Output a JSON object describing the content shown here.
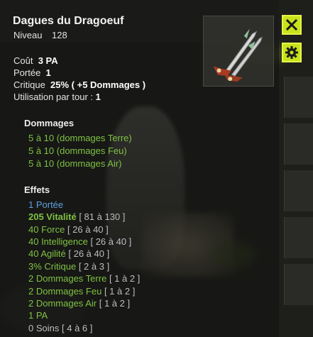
{
  "item": {
    "name": "Dagues du Dragoeuf",
    "level_label": "Niveau",
    "level_value": "128",
    "image_icon": "dragon-dagger-icon"
  },
  "buttons": {
    "close_icon": "close-icon",
    "settings_icon": "gear-icon",
    "accent": "#c8e21c"
  },
  "stats": {
    "cost_label": "Coût",
    "cost_value": "3 PA",
    "range_label": "Portée",
    "range_value": "1",
    "crit_label": "Critique",
    "crit_value": "25% ( +5 Dommages )",
    "uses_label": "Utilisation par tour :",
    "uses_value": "1"
  },
  "damages": {
    "title": "Dommages",
    "lines": [
      "5 à 10 (dommages Terre)",
      "5 à 10 (dommages Feu)",
      "5 à 10 (dommages Air)"
    ]
  },
  "effects": {
    "title": "Effets",
    "lines": [
      {
        "text": "1 Portée",
        "range": ""
      },
      {
        "text": "205 Vitalité",
        "range": "[ 81 à 130 ]"
      },
      {
        "text": "40 Force",
        "range": "[ 26 à 40 ]"
      },
      {
        "text": "40 Intelligence",
        "range": "[ 26 à 40 ]"
      },
      {
        "text": "40 Agilité",
        "range": "[ 26 à 40 ]"
      },
      {
        "text": "3% Critique",
        "range": "[ 2 à 3 ]"
      },
      {
        "text": "2 Dommages Terre",
        "range": "[ 1 à 2 ]"
      },
      {
        "text": "2 Dommages Feu",
        "range": "[ 1 à 2 ]"
      },
      {
        "text": "2 Dommages Air",
        "range": "[ 1 à 2 ]"
      },
      {
        "text": "1 PA",
        "range": ""
      },
      {
        "text": "0 Soins",
        "range": "[ 4 à 6 ]"
      }
    ]
  },
  "colors": {
    "damage_green": "#7fc243",
    "effect_blue": "#5fa0e0",
    "neutral_grey": "#bdbdbd"
  }
}
